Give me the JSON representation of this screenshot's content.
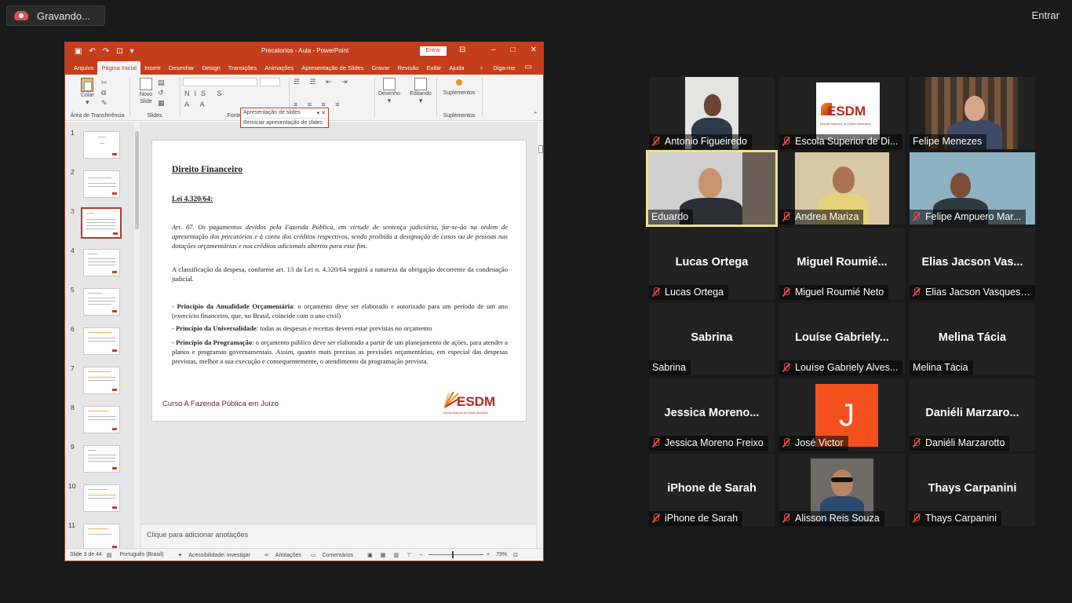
{
  "recording": {
    "label": "Gravando..."
  },
  "top_right": {
    "join_label": "Entrar"
  },
  "ppt": {
    "doc_title": "Precatorios - Aula  -  PowerPoint",
    "entrar_label": "Entrar",
    "tabs": [
      "Arquivo",
      "Página Inicial",
      "Inserir",
      "Desenhar",
      "Design",
      "Transições",
      "Animações",
      "Apresentação de Slides",
      "Gravar",
      "Revisão",
      "Exibir",
      "Ajuda"
    ],
    "tell_me": "Diga-me",
    "ribbon": {
      "paste_label": "Colar",
      "clipboard_group": "Área de Transferência",
      "new_slide_label": "Novo Slide",
      "slides_group": "Slides",
      "font_group": "Fonte",
      "drawing_label": "Desenho",
      "editing_label": "Editando",
      "addins_label": "Suplementos",
      "addins_group": "Suplementos"
    },
    "tooltip": {
      "title": "Apresentação de slides",
      "item": "Reiniciar apresentação de slides"
    },
    "thumbnails": [
      "1",
      "2",
      "3",
      "4",
      "5",
      "6",
      "7",
      "8",
      "9",
      "10",
      "11"
    ],
    "slide": {
      "title": "Direito Financeiro",
      "lei": "Lei 4.320/64:",
      "art": "Art. 67. Os pagamentos devidos pela Fazenda Pública, em virtude de sentença judiciária, far-se-ão na ordem de apresentação dos precatórios e à conta dos créditos respectivos, sendo proibida a designação de casos ou de pessoas nas dotações orçamentárias e nos créditos adicionais abertos para esse fim.",
      "classification": "A classificação da despesa, conforme art. 13 da Lei n. 4.320/64 seguirá a natureza da obrigação decorrente da condenação judicial.",
      "p1_bold": "Princípio da Anualidade Orçamentária",
      "p1_rest": ": o orçamento deve ser elaborado e autorizado para um período de um ano (exercício financeiro, que, no Brasil, coincide com o ano civil)",
      "p2_bold": "Princípio da Universalidade",
      "p2_rest": ": todas as despesas e receitas devem estar previstas no orçamento",
      "p3_bold": "Princípio da Programação",
      "p3_rest": ": o orçamento público deve ser elaborado a partir de um planejamento de ações, para atender a planos e programas governamentais. Assim, quanto mais precisas as previsões orçamentárias, em especial das despesas previstas, melhor a sua execução e consequentemente, o atendimento da programação prevista.",
      "footer": "Curso A Fazenda Pública em Juízo",
      "logo_text": "ESDM",
      "logo_sub": "Escola Superior de Direito Municipal"
    },
    "notes_placeholder": "Clique para adicionar anotações",
    "status": {
      "slide_counter": "Slide 3 de 44",
      "language": "Português (Brasil)",
      "accessibility": "Acessibilidade: investigar",
      "notes": "Anotações",
      "comments": "Comentários",
      "zoom": "79%"
    }
  },
  "participants": [
    {
      "id": "antonio",
      "label": "Antonio Figueiredo",
      "muted": true,
      "video": true
    },
    {
      "id": "esdm",
      "label": "Escola Superior de Di...",
      "muted": true,
      "video": true
    },
    {
      "id": "felipe-m",
      "label": "Felipe Menezes",
      "muted": false,
      "video": true
    },
    {
      "id": "eduardo",
      "label": "Eduardo",
      "muted": false,
      "video": true,
      "speaking": true
    },
    {
      "id": "andrea",
      "label": "Andrea Mariza",
      "muted": true,
      "video": true
    },
    {
      "id": "felipe-a",
      "label": "Felipe Ampuero Mar...",
      "muted": true,
      "video": true
    },
    {
      "id": "lucas",
      "center_name": "Lucas Ortega",
      "label": "Lucas Ortega",
      "muted": true
    },
    {
      "id": "miguel",
      "center_name": "Miguel  Roumié...",
      "label": "Miguel Roumié Neto",
      "muted": true
    },
    {
      "id": "elias",
      "center_name": "Elias Jacson Vas...",
      "label": "Elias Jacson Vasques ...",
      "muted": true
    },
    {
      "id": "sabrina",
      "center_name": "Sabrina",
      "label": "Sabrina",
      "muted": false
    },
    {
      "id": "louise",
      "center_name": "Louíse  Gabriely...",
      "label": "Louíse Gabriely Alves...",
      "muted": true
    },
    {
      "id": "melina",
      "center_name": "Melina Tácia",
      "label": "Melina Tácia",
      "muted": false
    },
    {
      "id": "jessica",
      "center_name": "Jessica  Moreno...",
      "label": "Jessica Moreno Freixo",
      "muted": true
    },
    {
      "id": "jose",
      "avatar_letter": "J",
      "label": "José Victor",
      "muted": true
    },
    {
      "id": "danieli",
      "center_name": "Daniéli  Marzaro...",
      "label": "Daniéli Marzarotto",
      "muted": true
    },
    {
      "id": "sarah",
      "center_name": "iPhone de Sarah",
      "label": "iPhone de Sarah",
      "muted": true
    },
    {
      "id": "alisson",
      "label": "Alisson Reis Souza",
      "muted": true,
      "video": true
    },
    {
      "id": "thays",
      "center_name": "Thays Carpanini",
      "label": "Thays Carpanini",
      "muted": true
    }
  ],
  "colors": {
    "ppt_red": "#c43e1c",
    "speaking_border": "#e6e58c",
    "avatar_orange": "#f4511e",
    "mic_muted": "#e04b4b"
  }
}
